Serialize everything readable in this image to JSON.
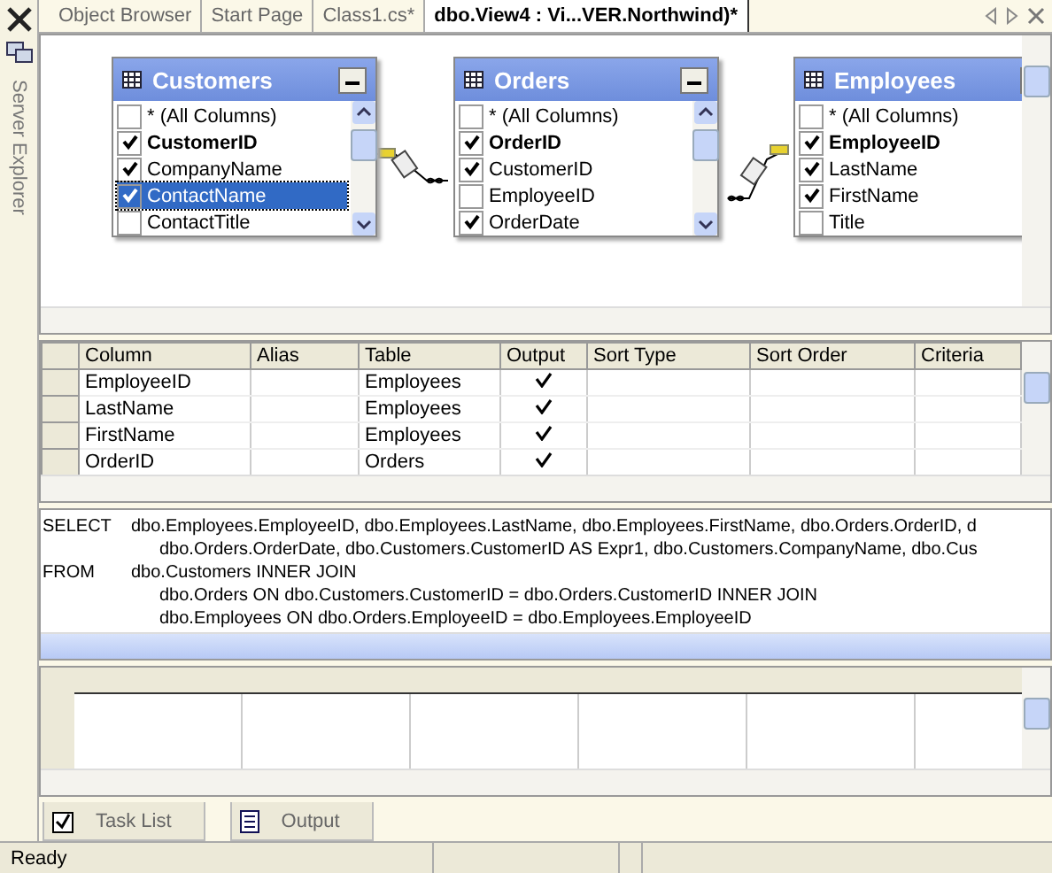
{
  "side_panel": {
    "label": "Server Explorer"
  },
  "tabs": [
    {
      "label": "Object Browser",
      "selected": false
    },
    {
      "label": "Start Page",
      "selected": false
    },
    {
      "label": "Class1.cs*",
      "selected": false
    },
    {
      "label": "dbo.View4 : Vi...VER.Northwind)*",
      "selected": true
    }
  ],
  "diagram": {
    "tables": [
      {
        "title": "Customers",
        "columns": [
          {
            "name": "* (All Columns)",
            "checked": false,
            "primary_key": false,
            "selected": false
          },
          {
            "name": "CustomerID",
            "checked": true,
            "primary_key": true,
            "selected": false
          },
          {
            "name": "CompanyName",
            "checked": true,
            "primary_key": false,
            "selected": false
          },
          {
            "name": "ContactName",
            "checked": true,
            "primary_key": false,
            "selected": true
          },
          {
            "name": "ContactTitle",
            "checked": false,
            "primary_key": false,
            "selected": false
          }
        ]
      },
      {
        "title": "Orders",
        "columns": [
          {
            "name": "* (All Columns)",
            "checked": false,
            "primary_key": false,
            "selected": false
          },
          {
            "name": "OrderID",
            "checked": true,
            "primary_key": true,
            "selected": false
          },
          {
            "name": "CustomerID",
            "checked": true,
            "primary_key": false,
            "selected": false
          },
          {
            "name": "EmployeeID",
            "checked": false,
            "primary_key": false,
            "selected": false
          },
          {
            "name": "OrderDate",
            "checked": true,
            "primary_key": false,
            "selected": false
          }
        ]
      },
      {
        "title": "Employees",
        "columns": [
          {
            "name": "* (All Columns)",
            "checked": false,
            "primary_key": false,
            "selected": false
          },
          {
            "name": "EmployeeID",
            "checked": true,
            "primary_key": true,
            "selected": false
          },
          {
            "name": "LastName",
            "checked": true,
            "primary_key": false,
            "selected": false
          },
          {
            "name": "FirstName",
            "checked": true,
            "primary_key": false,
            "selected": false
          },
          {
            "name": "Title",
            "checked": false,
            "primary_key": false,
            "selected": false
          }
        ]
      }
    ]
  },
  "grid": {
    "columns": [
      "Column",
      "Alias",
      "Table",
      "Output",
      "Sort Type",
      "Sort Order",
      "Criteria"
    ],
    "rows": [
      {
        "column": "EmployeeID",
        "table": "Employees",
        "output": true
      },
      {
        "column": "LastName",
        "table": "Employees",
        "output": true
      },
      {
        "column": "FirstName",
        "table": "Employees",
        "output": true
      },
      {
        "column": "OrderID",
        "table": "Orders",
        "output": true
      }
    ]
  },
  "sql": [
    {
      "keyword": "SELECT",
      "text": "dbo.Employees.EmployeeID, dbo.Employees.LastName, dbo.Employees.FirstName, dbo.Orders.OrderID, d"
    },
    {
      "text": "dbo.Orders.OrderDate, dbo.Customers.CustomerID AS Expr1, dbo.Customers.CompanyName, dbo.Cus"
    },
    {
      "keyword": "FROM",
      "text": "dbo.Customers INNER JOIN"
    },
    {
      "text": "dbo.Orders ON dbo.Customers.CustomerID = dbo.Orders.CustomerID INNER JOIN"
    },
    {
      "text": "dbo.Employees ON dbo.Orders.EmployeeID = dbo.Employees.EmployeeID"
    }
  ],
  "bottom_tabs": [
    {
      "label": "Task List",
      "kind": "tasks"
    },
    {
      "label": "Output",
      "kind": "output"
    }
  ],
  "status_bar": {
    "text": "Ready"
  }
}
